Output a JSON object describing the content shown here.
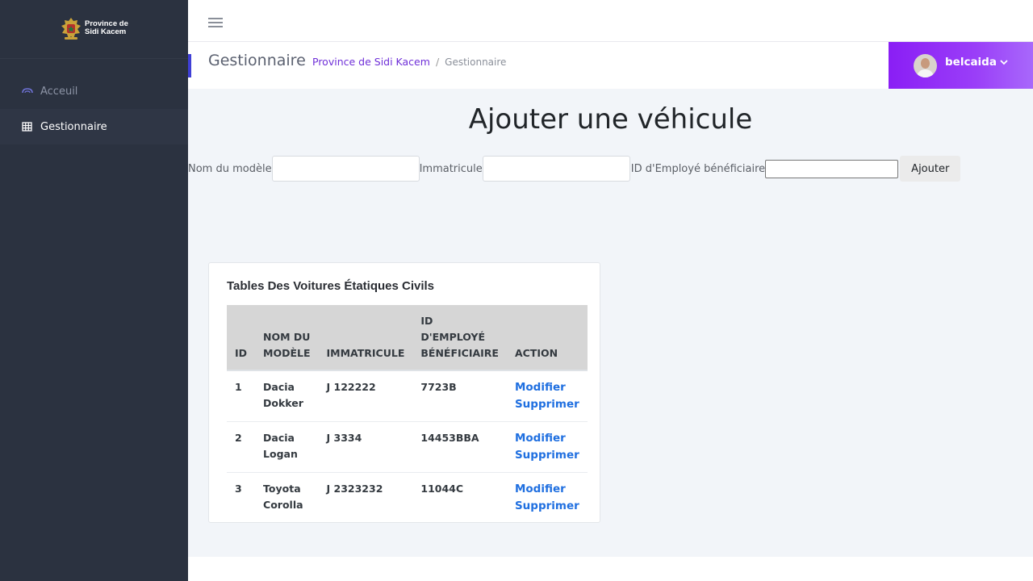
{
  "brand": {
    "line1": "Province de",
    "line2": "Sidi Kacem"
  },
  "sidebar": {
    "items": [
      {
        "label": "Acceuil",
        "icon": "cloud-icon"
      },
      {
        "label": "Gestionnaire",
        "icon": "table-icon"
      }
    ]
  },
  "header": {
    "title": "Gestionnaire",
    "breadcrumb": {
      "link": "Province de Sidi Kacem",
      "separator": "/",
      "current": "Gestionnaire"
    },
    "user": {
      "name": "belcaida"
    }
  },
  "main": {
    "heading": "Ajouter une véhicule",
    "form": {
      "model_label": "Nom du modèle",
      "model_value": "",
      "plate_label": "Immatricule",
      "plate_value": "",
      "employee_label": "ID d'Employé bénéficiaire",
      "employee_value": "",
      "submit_label": "Ajouter"
    },
    "table": {
      "title": "Tables Des Voitures Étatiques Civils",
      "columns": [
        "ID",
        "NOM DU MODÈLE",
        "IMMATRICULE",
        "ID D'EMPLOYÉ BÉNÉFICIAIRE",
        "ACTION"
      ],
      "rows": [
        {
          "id": "1",
          "model": "Dacia Dokker",
          "plate": "J 122222",
          "employee": "7723B",
          "edit": "Modifier",
          "delete": "Supprimer"
        },
        {
          "id": "2",
          "model": "Dacia Logan",
          "plate": "J 3334",
          "employee": "14453BBA",
          "edit": "Modifier",
          "delete": "Supprimer"
        },
        {
          "id": "3",
          "model": "Toyota Corolla",
          "plate": "J 2323232",
          "employee": "11044C",
          "edit": "Modifier",
          "delete": "Supprimer"
        }
      ]
    }
  },
  "colors": {
    "sidebar": "#2b3240",
    "accent": "#8a1ef5",
    "link": "#1f6fe0",
    "breadcrumb_link": "#6f2fd8"
  }
}
